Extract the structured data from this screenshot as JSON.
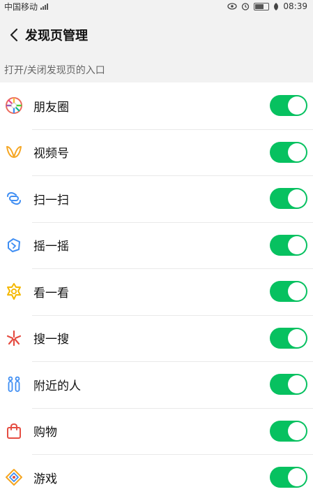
{
  "status": {
    "carrier": "中国移动",
    "time": "08:39",
    "icons": [
      "signal-icon",
      "eye-icon",
      "alarm-icon",
      "battery-icon",
      "leaf-icon"
    ]
  },
  "header": {
    "title": "发现页管理",
    "back_icon": "back-chevron-icon"
  },
  "section_hint": "打开/关闭发现页的入口",
  "accent_color": "#07c160",
  "items": [
    {
      "label": "朋友圈",
      "icon": "moments-icon",
      "enabled": true
    },
    {
      "label": "视频号",
      "icon": "channels-icon",
      "enabled": true
    },
    {
      "label": "扫一扫",
      "icon": "scan-icon",
      "enabled": true
    },
    {
      "label": "摇一摇",
      "icon": "shake-icon",
      "enabled": true
    },
    {
      "label": "看一看",
      "icon": "top-stories-icon",
      "enabled": true
    },
    {
      "label": "搜一搜",
      "icon": "search-icon",
      "enabled": true
    },
    {
      "label": "附近的人",
      "icon": "people-nearby-icon",
      "enabled": true
    },
    {
      "label": "购物",
      "icon": "shopping-bag-icon",
      "enabled": true
    },
    {
      "label": "游戏",
      "icon": "game-icon",
      "enabled": true
    }
  ]
}
